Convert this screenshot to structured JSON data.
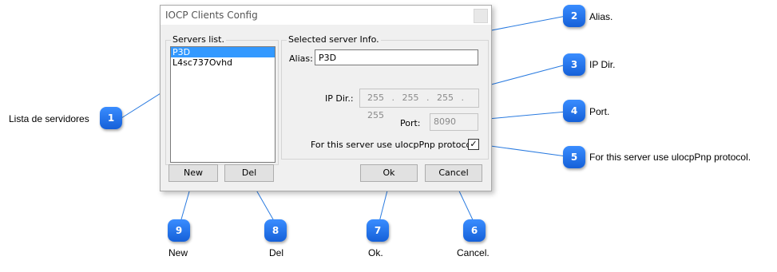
{
  "dialog": {
    "title": "IOCP Clients Config",
    "servers_group_label": "Servers list.",
    "servers": [
      "P3D",
      "L4sc737Ovhd"
    ],
    "selected_server": "P3D",
    "info_group_label": "Selected server Info.",
    "alias_label": "Alias:",
    "alias_value": "P3D",
    "ipdir_label": "IP Dir.:",
    "ip_octets": [
      "255",
      "255",
      "255",
      "255"
    ],
    "ip_separator": ".",
    "port_label": "Port:",
    "port_value": "8090",
    "protocol_label": "For this server use uIocpPnp protocol:",
    "protocol_checked": true,
    "check_mark": "✓",
    "new_label": "New",
    "del_label": "Del",
    "ok_label": "Ok",
    "cancel_label": "Cancel"
  },
  "callouts": [
    {
      "number": "1",
      "text": "Lista de servidores"
    },
    {
      "number": "2",
      "text": "Alias."
    },
    {
      "number": "3",
      "text": "IP Dir."
    },
    {
      "number": "4",
      "text": "Port."
    },
    {
      "number": "5",
      "text": "For this server use ulocpPnp protocol."
    },
    {
      "number": "6",
      "text": "Cancel."
    },
    {
      "number": "7",
      "text": "Ok."
    },
    {
      "number": "8",
      "text": "Del"
    },
    {
      "number": "9",
      "text": "New"
    }
  ],
  "colors": {
    "accent": "#1e6fe6",
    "selection": "#3399ff",
    "dialog_bg": "#f0f0f0"
  }
}
